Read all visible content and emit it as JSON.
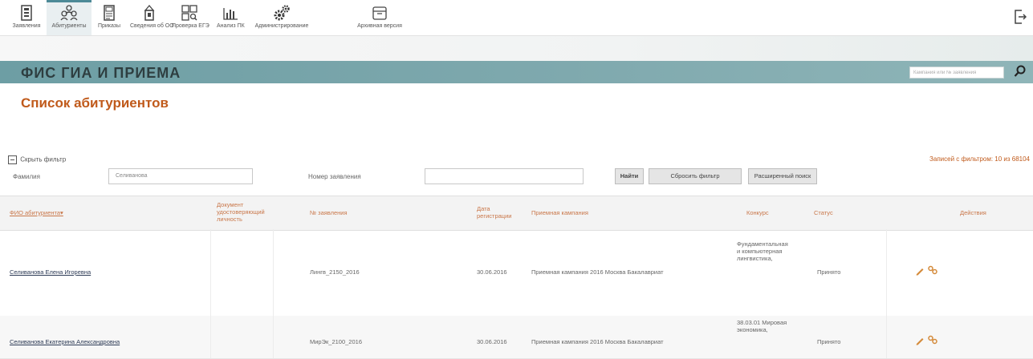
{
  "nav": {
    "items": [
      {
        "label": "Заявления",
        "icon": "document-icon"
      },
      {
        "label": "Абитуриенты",
        "icon": "users-icon"
      },
      {
        "label": "Приказы",
        "icon": "orders-icon"
      },
      {
        "label": "Сведения об ОО",
        "icon": "institution-icon"
      },
      {
        "label": "Проверка ЕГЭ",
        "icon": "exam-check-icon"
      },
      {
        "label": "Анализ ПК",
        "icon": "analytics-icon"
      },
      {
        "label": "Администрирование",
        "icon": "gears-icon"
      },
      {
        "label": "Архивная версия",
        "icon": "archive-icon"
      }
    ],
    "active": "Абитуриенты"
  },
  "header": {
    "brand": "ФИС ГИА И ПРИЕМА",
    "search_placeholder": "Кампания или № заявления"
  },
  "page": {
    "title": "Список абитуриентов"
  },
  "filter": {
    "toggle_label": "Скрыть фильтр",
    "records_info": "Записей с фильтром: 10 из 68104",
    "surname_label": "Фамилия",
    "surname_value": "Селиванова",
    "application_label": "Номер заявления",
    "application_value": "",
    "find_button": "Найти",
    "reset_button": "Сбросить фильтр",
    "advanced_button": "Расширенный поиск"
  },
  "table": {
    "headers": {
      "fio": "ФИО абитуриента",
      "document": "Документ удостоверяющий личность",
      "app_number": "№ заявления",
      "reg_date": "Дата регистрации",
      "campaign": "Приемная кампания",
      "competition": "Конкурс",
      "status": "Статус",
      "actions": "Действия"
    },
    "rows": [
      {
        "fio": "Селиванова Елена Игоревна",
        "document": "",
        "app_number": "Лингв_2150_2016",
        "reg_date": "30.06.2016",
        "campaign": "Приемная кампания 2016 Москва Бакалавриат",
        "competition": "Фундаментальная и компьютерная лингвистика,",
        "status": "Принято"
      },
      {
        "fio": "Селиванова Екатерина Александровна",
        "document": "",
        "app_number": "МирЭк_2100_2016",
        "reg_date": "30.06.2016",
        "campaign": "Приемная кампания 2016 Москва Бакалавриат",
        "competition": "38.03.01 Мировая экономика,",
        "status": "Принято"
      }
    ]
  },
  "colors": {
    "accent": "#c05a1b",
    "banner": "#7fa9ae",
    "link": "#2c3a55"
  }
}
